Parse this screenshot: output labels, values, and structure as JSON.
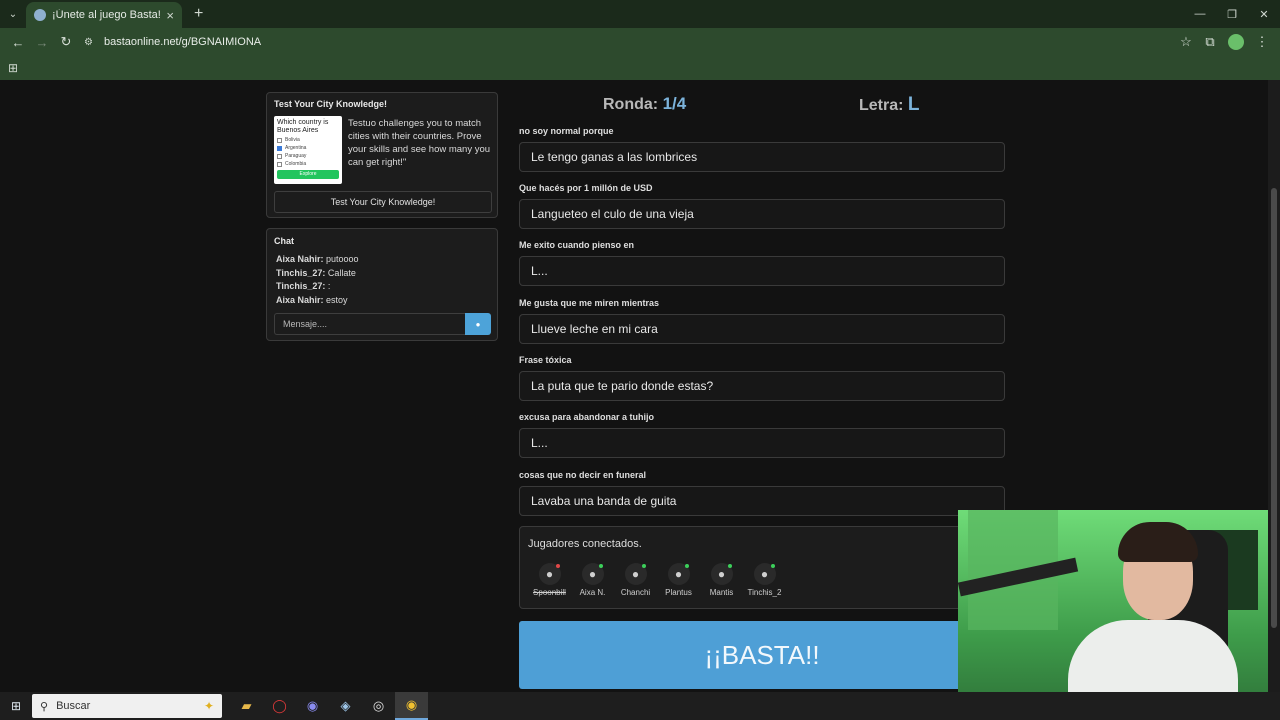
{
  "browser": {
    "tab_title": "¡Únete al juego Basta!",
    "url": "bastaonline.net/g/BGNAIMIONA"
  },
  "ad": {
    "title": "Test Your City Knowledge!",
    "image_title": "Which country is Buenos Aires",
    "image_options": [
      "Bolivia",
      "Argentina",
      "Paraguay",
      "Colombia"
    ],
    "image_button": "Explore",
    "text": "Testuo challenges you to match cities with their countries. Prove your skills and see how many you can get right!\"",
    "button_label": "Test Your City Knowledge!"
  },
  "chat": {
    "title": "Chat",
    "messages": [
      {
        "user": "Aixa Nahir:",
        "text": " putoooo"
      },
      {
        "user": "Tinchis_27:",
        "text": " Callate"
      },
      {
        "user": "Tinchis_27:",
        "text": " :"
      },
      {
        "user": "Aixa Nahir:",
        "text": " estoy"
      }
    ],
    "input_placeholder": "Mensaje...."
  },
  "game": {
    "round_label": "Ronda:",
    "round_value": "1/4",
    "letter_label": "Letra:",
    "letter_value": "L",
    "fields": [
      {
        "label": "no soy normal porque",
        "value": "Le tengo ganas a las lombrices"
      },
      {
        "label": "Que hacés por 1 millón de USD",
        "value": "Langueteo el culo de una vieja"
      },
      {
        "label": "Me exito cuando pienso en",
        "value": "L..."
      },
      {
        "label": "Me gusta que me miren mientras",
        "value": "Llueve leche en mi cara"
      },
      {
        "label": "Frase tóxica",
        "value": "La puta que te pario donde estas?"
      },
      {
        "label": "excusa para abandonar a tuhijo",
        "value": "L..."
      },
      {
        "label": "cosas que no decir en funeral",
        "value": "Lavaba una banda de guita"
      }
    ],
    "players_title": "Jugadores conectados.",
    "players": [
      {
        "name": "Spoonbill",
        "struck": true,
        "status_color": "#e04848"
      },
      {
        "name": "Aixa N.",
        "struck": false,
        "status_color": "#3ccf5a"
      },
      {
        "name": "Chanchi",
        "struck": false,
        "status_color": "#3ccf5a"
      },
      {
        "name": "Plantus",
        "struck": false,
        "status_color": "#3ccf5a"
      },
      {
        "name": "Mantis",
        "struck": false,
        "status_color": "#3ccf5a"
      },
      {
        "name": "Tinchis_2",
        "struck": false,
        "status_color": "#3ccf5a"
      }
    ],
    "basta_label": "¡¡BASTA!!"
  },
  "taskbar": {
    "search_placeholder": "Buscar"
  },
  "colors": {
    "accent": "#4e9fd6",
    "highlight": "#7cb3db"
  }
}
